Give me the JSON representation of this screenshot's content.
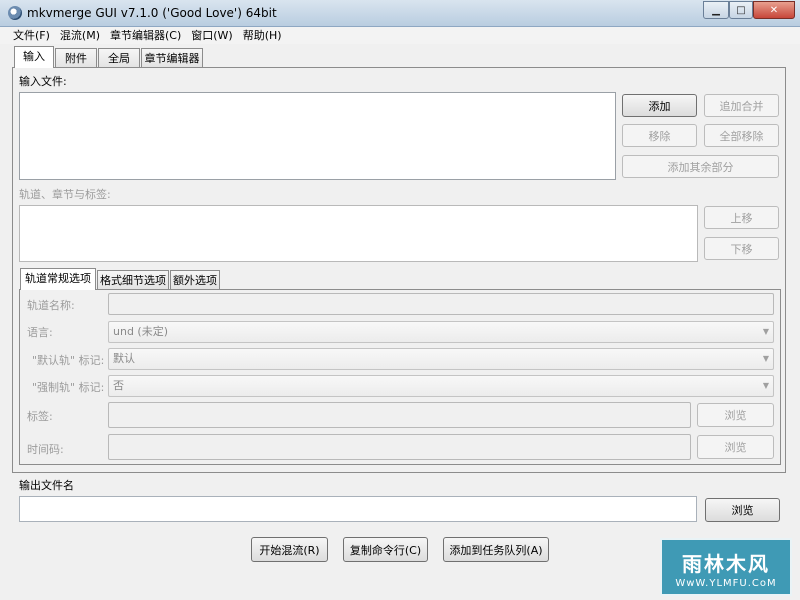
{
  "window": {
    "title": "mkvmerge GUI v7.1.0 ('Good Love') 64bit"
  },
  "menu": [
    "文件(F)",
    "混流(M)",
    "章节编辑器(C)",
    "窗口(W)",
    "帮助(H)"
  ],
  "main_tabs": [
    "输入",
    "附件",
    "全局",
    "章节编辑器"
  ],
  "input": {
    "files_label": "输入文件:",
    "buttons": {
      "add": "添加",
      "append": "追加合并",
      "remove": "移除",
      "remove_all": "全部移除",
      "add_parts": "添加其余部分"
    }
  },
  "tracks": {
    "label": "轨道、章节与标签:",
    "buttons": {
      "up": "上移",
      "down": "下移"
    }
  },
  "options_tabs": [
    "轨道常规选项",
    "格式细节选项",
    "额外选项"
  ],
  "options": {
    "track_name_label": "轨道名称:",
    "language_label": "语言:",
    "language_value": "und (未定)",
    "default_flag_label": "\"默认轨\" 标记:",
    "default_flag_value": "默认",
    "forced_flag_label": "\"强制轨\" 标记:",
    "forced_flag_value": "否",
    "tags_label": "标签:",
    "tags_browse": "浏览",
    "timecodes_label": "时间码:",
    "timecodes_browse": "浏览"
  },
  "output": {
    "label": "输出文件名",
    "value": "",
    "browse": "浏览"
  },
  "actions": {
    "start": "开始混流(R)",
    "copy_cmd": "复制命令行(C)",
    "add_queue": "添加到任务队列(A)"
  },
  "watermark": {
    "brand": "雨林木风",
    "url": "WwW.YLMFU.CoM"
  }
}
